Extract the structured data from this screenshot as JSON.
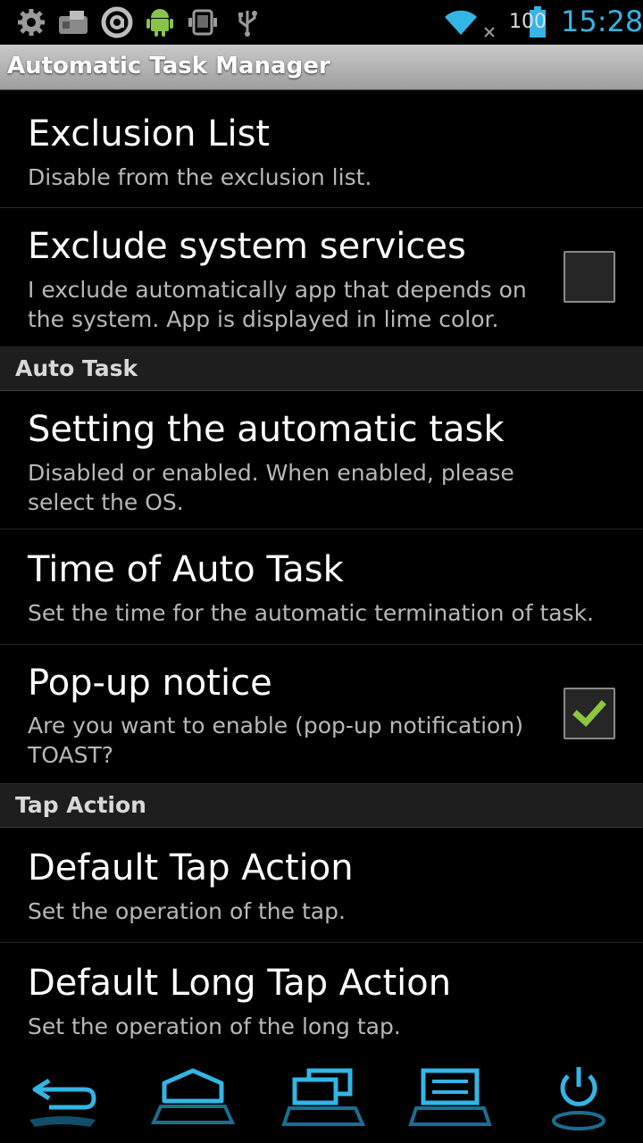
{
  "status_bar": {
    "left_icons": [
      "gear-icon",
      "fax-icon",
      "circle-a-icon",
      "android-icon",
      "robot-icon",
      "usb-icon"
    ],
    "right_icons": [
      "wifi-icon",
      "no-signal-icon",
      "battery-icon"
    ],
    "battery_level": "100",
    "time": "15:28"
  },
  "app": {
    "title": "Automatic Task Manager"
  },
  "prefs": {
    "exclusion_list": {
      "title": "Exclusion List",
      "summary": "Disable from the exclusion list."
    },
    "exclude_system": {
      "title": "Exclude system services",
      "summary": "I exclude automatically app that depends on the system. App is displayed in lime color.",
      "checked": false
    },
    "auto_task_header": "Auto Task",
    "setting_auto_task": {
      "title": "Setting the automatic task",
      "summary": "Disabled or enabled. When enabled, please select the OS."
    },
    "time_auto_task": {
      "title": "Time of Auto Task",
      "summary": "Set the time for the automatic termination of task."
    },
    "popup_notice": {
      "title": "Pop-up notice",
      "summary": "Are you want to enable (pop-up notification) TOAST?",
      "checked": true
    },
    "tap_action_header": "Tap Action",
    "default_tap": {
      "title": "Default Tap Action",
      "summary": "Set the operation of the tap."
    },
    "default_long_tap": {
      "title": "Default Long Tap Action",
      "summary": "Set the operation of the long tap."
    }
  },
  "nav_bar": {
    "buttons": [
      "back-icon",
      "home-icon",
      "recent-apps-icon",
      "menu-icon",
      "power-icon"
    ]
  },
  "colors": {
    "accent_blue": "#33b5e5",
    "check_green": "#8cc63f"
  }
}
